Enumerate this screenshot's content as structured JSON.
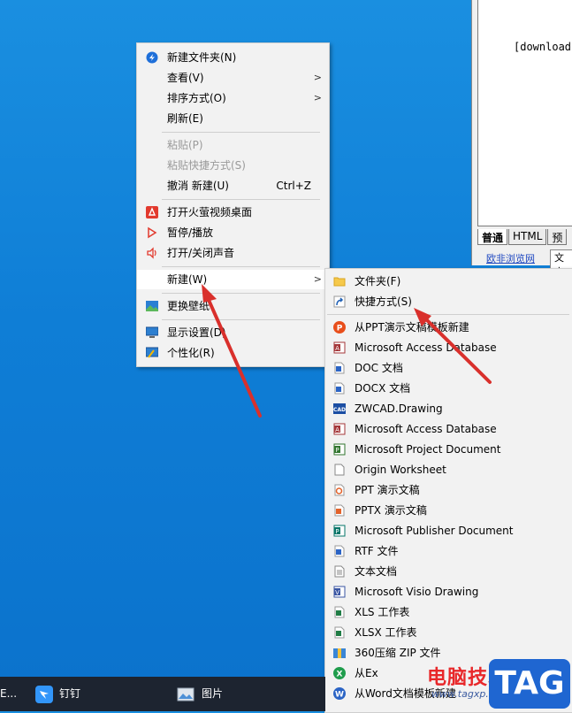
{
  "window": {
    "content_text": "[download]",
    "tabs": [
      "普通",
      "HTML",
      "预"
    ],
    "link_text": "欧非浏览网",
    "button_text": "文字"
  },
  "main_menu": {
    "items": [
      {
        "label": "新建文件夹(N)",
        "icon": "new-folder-icon"
      },
      {
        "label": "查看(V)",
        "submenu": true
      },
      {
        "label": "排序方式(O)",
        "submenu": true
      },
      {
        "label": "刷新(E)"
      },
      {
        "label": "粘贴(P)",
        "disabled": true
      },
      {
        "label": "粘贴快捷方式(S)",
        "disabled": true
      },
      {
        "label": "撤消 新建(U)",
        "shortcut": "Ctrl+Z"
      },
      {
        "label": "打开火萤视频桌面",
        "icon": "firefly-icon"
      },
      {
        "label": "暂停/播放",
        "icon": "play-icon"
      },
      {
        "label": "打开/关闭声音",
        "icon": "sound-icon"
      },
      {
        "label": "新建(W)",
        "submenu": true
      },
      {
        "label": "更换壁纸",
        "icon": "wallpaper-icon"
      },
      {
        "label": "显示设置(D)",
        "icon": "display-icon"
      },
      {
        "label": "个性化(R)",
        "icon": "personalize-icon"
      }
    ]
  },
  "new_submenu": {
    "items": [
      {
        "label": "文件夹(F)",
        "icon": "folder-icon"
      },
      {
        "label": "快捷方式(S)",
        "icon": "shortcut-icon"
      },
      {
        "label": "从PPT演示文稿模板新建",
        "icon": "ppt-template-icon"
      },
      {
        "label": "Microsoft Access Database",
        "icon": "access-icon"
      },
      {
        "label": "DOC 文档",
        "icon": "doc-icon"
      },
      {
        "label": "DOCX 文档",
        "icon": "docx-icon"
      },
      {
        "label": "ZWCAD.Drawing",
        "icon": "cad-icon"
      },
      {
        "label": "Microsoft Access Database",
        "icon": "access-icon"
      },
      {
        "label": "Microsoft Project Document",
        "icon": "project-icon"
      },
      {
        "label": "Origin Worksheet",
        "icon": "blank-file-icon"
      },
      {
        "label": "PPT 演示文稿",
        "icon": "ppt-icon"
      },
      {
        "label": "PPTX 演示文稿",
        "icon": "pptx-icon"
      },
      {
        "label": "Microsoft Publisher Document",
        "icon": "publisher-icon"
      },
      {
        "label": "RTF 文件",
        "icon": "rtf-icon"
      },
      {
        "label": "文本文档",
        "icon": "text-file-icon"
      },
      {
        "label": "Microsoft Visio Drawing",
        "icon": "visio-icon"
      },
      {
        "label": "XLS 工作表",
        "icon": "xls-icon"
      },
      {
        "label": "XLSX 工作表",
        "icon": "xlsx-icon"
      },
      {
        "label": "360压缩 ZIP 文件",
        "icon": "zip-icon"
      },
      {
        "label": "从Ex",
        "icon": "excel-template-icon"
      },
      {
        "label": "从Word文档模板新建",
        "icon": "word-template-icon"
      }
    ]
  },
  "taskbar": {
    "items": [
      {
        "label": "E..."
      },
      {
        "label": "钉钉",
        "icon": "dingtalk-icon"
      },
      {
        "label": "图片",
        "icon": "photos-icon"
      }
    ]
  },
  "watermark": {
    "site_name": "电脑技术网",
    "url": "www.tagxp.com",
    "badge": "TAG"
  },
  "colors": {
    "desktop": "#0f7ed6",
    "taskbar": "#1d2430",
    "arrow": "#d9302c",
    "badge": "#1f66d1"
  }
}
